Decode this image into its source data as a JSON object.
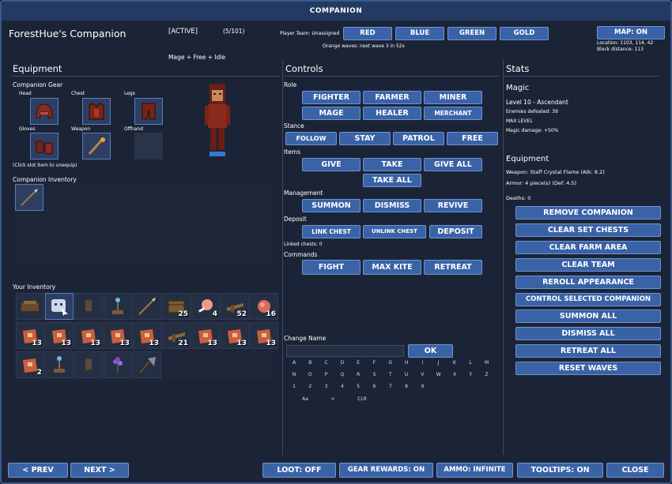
{
  "window_title": "COMPANION",
  "header": {
    "companion_name": "ForestHue's Companion",
    "active_label": "[ACTIVE]",
    "count": "(5/101)",
    "mode": "Mage + Free + Idle",
    "player_team_label": "Player Team: Unassigned",
    "teams": [
      "RED",
      "BLUE",
      "GREEN",
      "GOLD"
    ],
    "waves_text": "Orange waves: next wave 3 in 52s",
    "map_button": "MAP: ON",
    "location": "Location: 1103, 114, 42",
    "block_distance": "Block distance: 113"
  },
  "equipment": {
    "title": "Equipment",
    "gear_title": "Companion Gear",
    "slots": {
      "head": "Head",
      "chest": "Chest",
      "legs": "Legs",
      "gloves": "Gloves",
      "weapon": "Weapon",
      "offhand": "Offhand"
    },
    "unequip_hint": "(Click slot item to unequip)",
    "companion_inventory_title": "Companion Inventory",
    "your_inventory_title": "Your Inventory",
    "inventory_counts": [
      "",
      "",
      "",
      "",
      "",
      "25",
      "4",
      "52",
      "16",
      "13",
      "13",
      "13",
      "13",
      "13",
      "21",
      "13",
      "13",
      "13",
      "2",
      "",
      "",
      "",
      ""
    ]
  },
  "controls": {
    "title": "Controls",
    "role_label": "Role",
    "roles": [
      "FIGHTER",
      "FARMER",
      "MINER",
      "MAGE",
      "HEALER",
      "MERCHANT"
    ],
    "stance_label": "Stance",
    "stances": [
      "FOLLOW",
      "STAY",
      "PATROL",
      "FREE"
    ],
    "items_label": "Items",
    "items": [
      "GIVE",
      "TAKE",
      "GIVE ALL",
      "TAKE ALL"
    ],
    "management_label": "Management",
    "management": [
      "SUMMON",
      "DISMISS",
      "REVIVE"
    ],
    "deposit_label": "Deposit",
    "deposit": [
      "LINK CHEST",
      "UNLINK CHEST",
      "DEPOSIT"
    ],
    "linked_chests": "Linked chests: 0",
    "commands_label": "Commands",
    "commands": [
      "FIGHT",
      "MAX KITE",
      "RETREAT"
    ],
    "change_name_label": "Change Name",
    "name_value": "",
    "ok_button": "OK",
    "keyboard_rows": [
      [
        "A",
        "B",
        "C",
        "D",
        "E",
        "F",
        "G",
        "H",
        "I",
        "J",
        "K",
        "L",
        "M"
      ],
      [
        "N",
        "O",
        "P",
        "Q",
        "R",
        "S",
        "T",
        "U",
        "V",
        "W",
        "X",
        "Y",
        "Z"
      ],
      [
        "1",
        "2",
        "3",
        "4",
        "5",
        "6",
        "7",
        "8",
        "9"
      ]
    ],
    "keyboard_special": [
      "Aa",
      "<",
      "CLR"
    ]
  },
  "stats": {
    "title": "Stats",
    "magic_title": "Magic",
    "level": "Level 10 - Ascendant",
    "enemies": "Enemies defeated: 39",
    "max_level": "MAX LEVEL",
    "magic_damage": "Magic damage: +50%",
    "equipment_title": "Equipment",
    "weapon": "Weapon: Staff Crystal Flame (Atk: 8.2)",
    "armor": "Armor: 4 piece(s) (Def: 4.5)",
    "deaths": "Deaths: 0",
    "actions": [
      "REMOVE COMPANION",
      "CLEAR SET CHESTS",
      "CLEAR FARM AREA",
      "CLEAR TEAM",
      "REROLL APPEARANCE",
      "CONTROL SELECTED COMPANION",
      "SUMMON ALL",
      "DISMISS ALL",
      "RETREAT ALL",
      "RESET WAVES"
    ]
  },
  "footer": {
    "prev": "< PREV",
    "next": "NEXT >",
    "loot": "LOOT: OFF",
    "gear_rewards": "GEAR REWARDS: ON",
    "ammo": "AMMO: INFINITE",
    "tooltips": "TOOLTIPS: ON",
    "close": "CLOSE"
  },
  "colors": {
    "accent": "#3a62a6",
    "accent_border": "#6e94d2",
    "panel_bg": "#1b2436",
    "title_bg": "#233a62"
  }
}
